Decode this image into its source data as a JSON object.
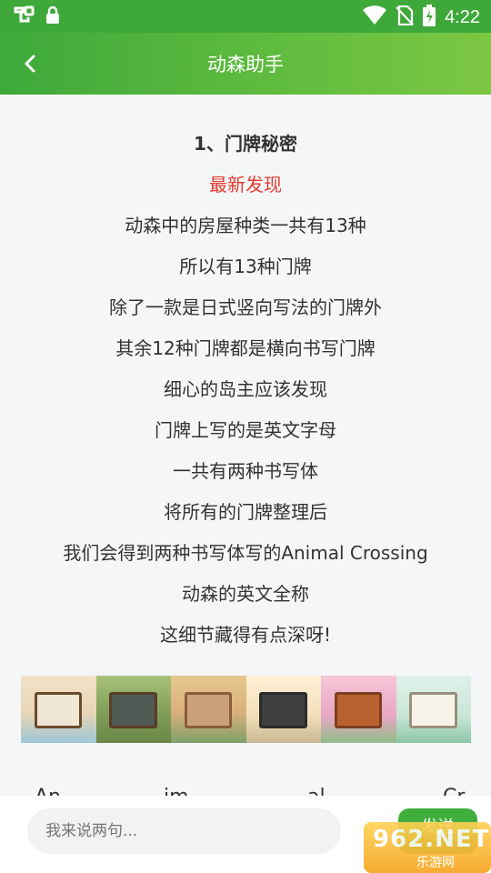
{
  "status_bar": {
    "time": "4:22",
    "icons": [
      "app-bug-icon",
      "lock-icon",
      "wifi-icon",
      "sim-off-icon",
      "battery-charging-icon"
    ]
  },
  "header": {
    "title": "动森助手",
    "back_icon": "back-arrow-icon"
  },
  "article": {
    "heading": "1、门牌秘密",
    "highlight": "最新发现",
    "lines": [
      "动森中的房屋种类一共有13种",
      "所以有13种门牌",
      "除了一款是日式竖向写法的门牌外",
      "其余12种门牌都是横向书写门牌",
      "细心的岛主应该发现",
      "门牌上写的是英文字母",
      "一共有两种书写体",
      "将所有的门牌整理后",
      "我们会得到两种书写体写的Animal Crossing",
      "动森的英文全称",
      "这细节藏得有点深呀!"
    ],
    "next_line_partial": [
      "An",
      "im",
      "al",
      "Cr"
    ]
  },
  "composer": {
    "placeholder": "我来说两句...",
    "send_label": "发送"
  },
  "watermark": {
    "text": "962.NET",
    "sub": "乐游网"
  },
  "colors": {
    "accent_green": "#3fa83a",
    "highlight_red": "#e33b2f"
  }
}
